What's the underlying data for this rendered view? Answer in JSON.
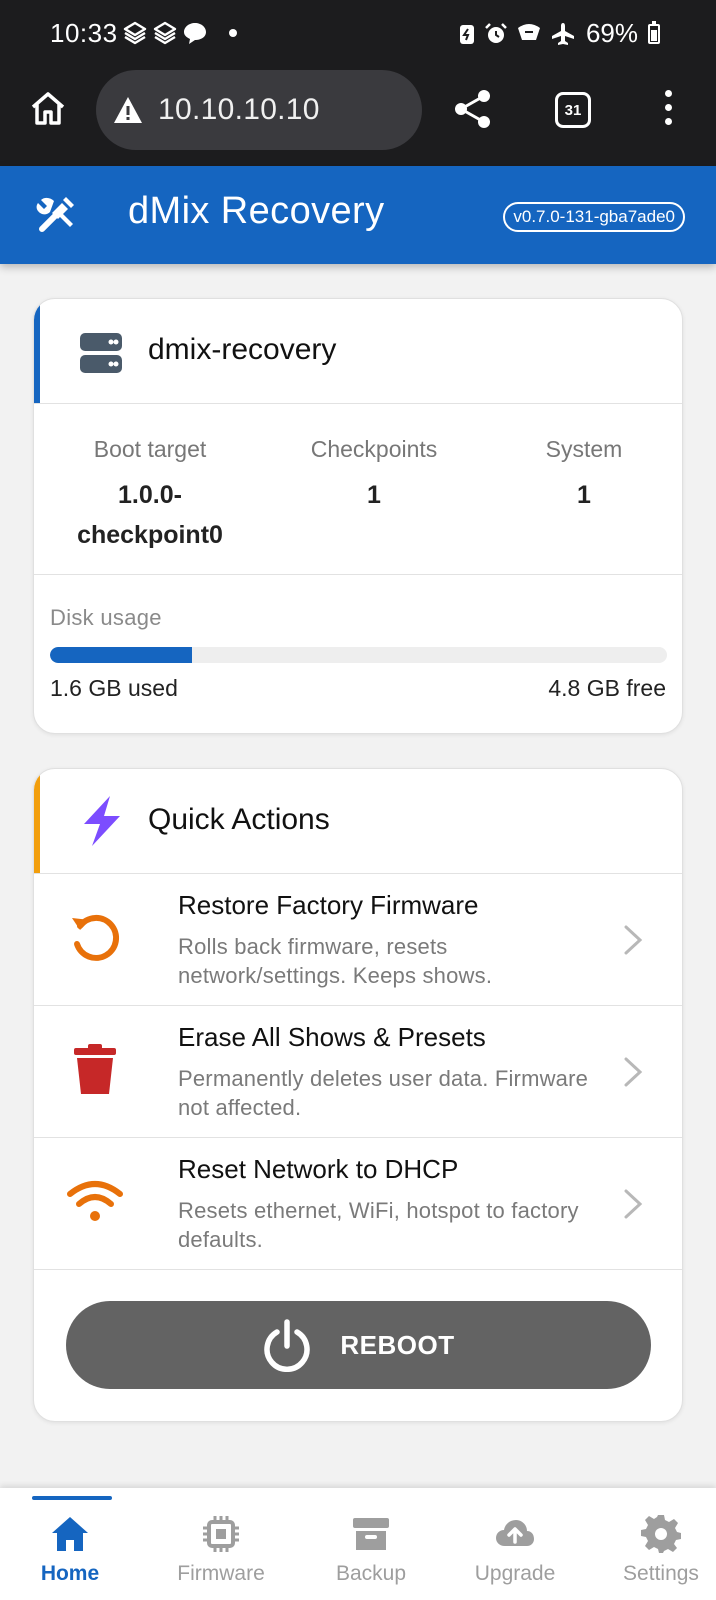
{
  "status_bar": {
    "time": "10:33",
    "battery_percent": "69%",
    "icons": [
      "app-notification-icon",
      "app-notification-icon",
      "message-icon",
      "battery-saver-icon",
      "alarm-icon",
      "wifi-calling-icon",
      "airplane-mode-icon",
      "battery-icon"
    ]
  },
  "browser": {
    "url": "10.10.10.10",
    "tab_count": "31",
    "icons": [
      "home-icon",
      "warning-icon",
      "share-icon",
      "tabs-icon",
      "more-vert-icon"
    ]
  },
  "app_bar": {
    "title": "dMix Recovery",
    "version": "v0.7.0-131-gba7ade0",
    "color": "#1565c0"
  },
  "device": {
    "hostname": "dmix-recovery",
    "stats": {
      "boot_target_label": "Boot target",
      "boot_target_value": "1.0.0-checkpoint0",
      "checkpoints_label": "Checkpoints",
      "checkpoints_value": "1",
      "system_label": "System",
      "system_value": "1"
    },
    "disk": {
      "label": "Disk usage",
      "used": "1.6 GB used",
      "free": "4.8 GB free",
      "used_fraction": 0.23
    }
  },
  "quick_actions": {
    "title": "Quick Actions",
    "accent_color": "#f29e0c",
    "items": [
      {
        "title": "Restore Factory Firmware",
        "description": "Rolls back firmware, resets network/settings. Keeps shows.",
        "icon": "restore-icon",
        "icon_color": "#e8710a"
      },
      {
        "title": "Erase All Shows & Presets",
        "description": "Permanently deletes user data. Firmware not affected.",
        "icon": "trash-icon",
        "icon_color": "#c62828"
      },
      {
        "title": "Reset Network to DHCP",
        "description": "Resets ethernet, WiFi, hotspot to factory defaults.",
        "icon": "wifi-icon",
        "icon_color": "#e8710a"
      }
    ],
    "reboot_label": "REBOOT"
  },
  "bottom_nav": {
    "active": "Home",
    "items": [
      {
        "label": "Home",
        "icon": "home-icon"
      },
      {
        "label": "Firmware",
        "icon": "chip-icon"
      },
      {
        "label": "Backup",
        "icon": "archive-icon"
      },
      {
        "label": "Upgrade",
        "icon": "cloud-upload-icon"
      },
      {
        "label": "Settings",
        "icon": "gear-icon"
      }
    ]
  }
}
